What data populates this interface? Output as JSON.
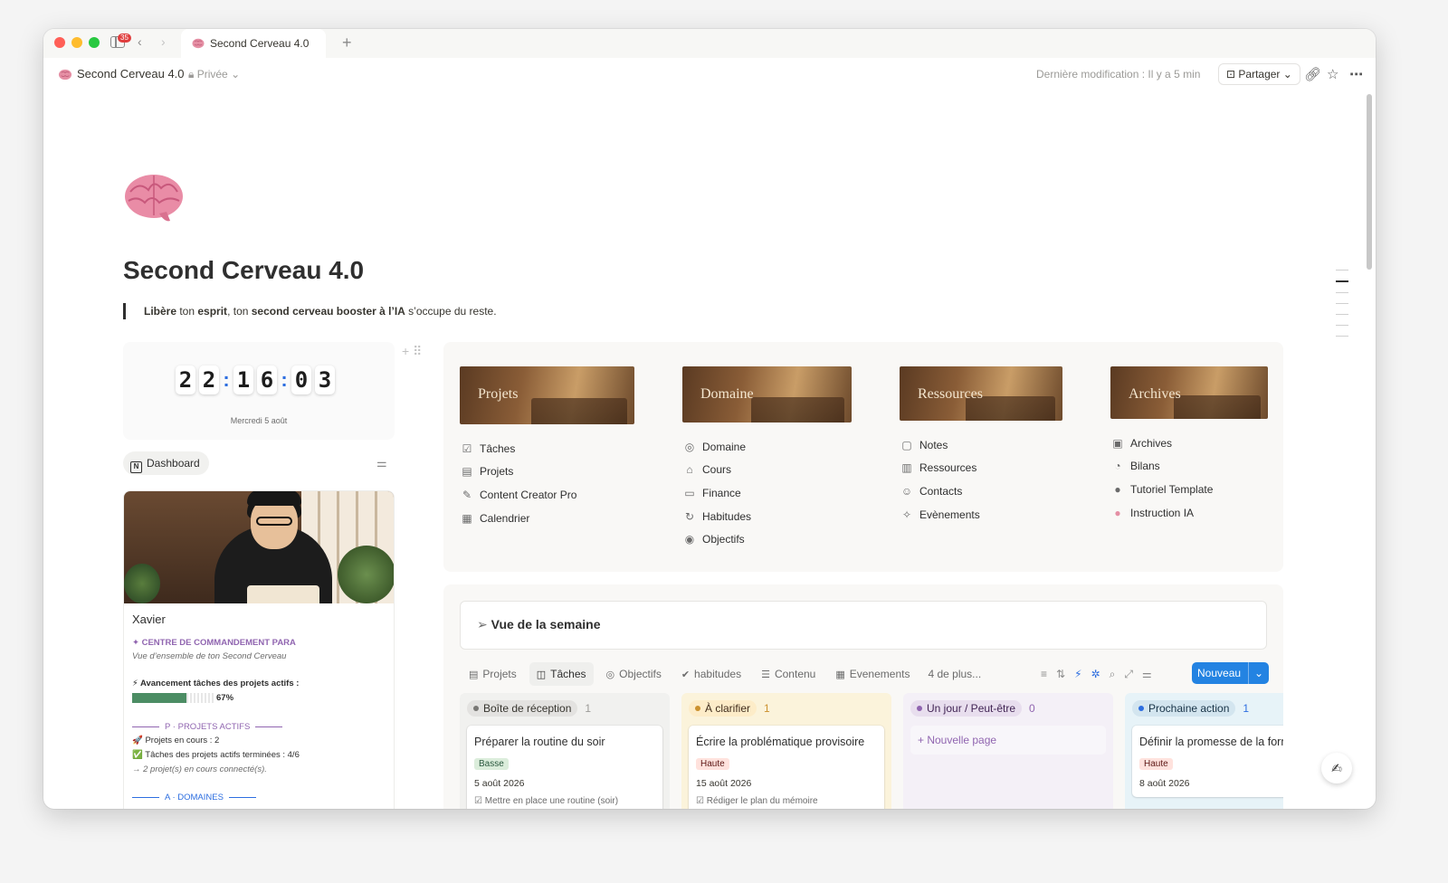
{
  "window": {
    "tab_title": "Second Cerveau 4.0",
    "notification_count": "35"
  },
  "topbar": {
    "breadcrumb": "Second Cerveau 4.0",
    "privacy": "Privée",
    "last_modified": "Dernière modification : Il y a 5 min",
    "share_label": "Partager"
  },
  "page": {
    "title": "Second Cerveau 4.0",
    "quote": {
      "part1": "Libère",
      "part2": " ton ",
      "part3": "esprit",
      "part4": ", ton ",
      "part5": "second cerveau booster à l’IA",
      "part6": " s’occupe du reste."
    }
  },
  "clock": {
    "digits": [
      "2",
      "2",
      "1",
      "6",
      "0",
      "3"
    ],
    "date": "Mercredi 5 août"
  },
  "dashboard": {
    "label": "Dashboard"
  },
  "profile": {
    "name": "Xavier",
    "heading": "✦ CENTRE DE COMMANDEMENT PARA",
    "subtitle": "Vue d’ensemble de ton Second Cerveau",
    "progress_label": "⚡ Avancement tâches des projets actifs :",
    "progress_pct": "67%",
    "progress_value": 0.67,
    "section_projects": "P · PROJETS ACTIFS",
    "projects_in_progress": "🚀 Projets en cours : 2",
    "projects_done": "✅ Tâches des projets actifs terminées : 4/6",
    "projects_linked": "→ 2 projet(s) en cours connecté(s).",
    "section_domains": "A · DOMAINES",
    "accent_purple": "#9065b0",
    "accent_blue": "#2d6ee0"
  },
  "categories": [
    {
      "cover": "Projets",
      "items": [
        "Tâches",
        "Projets",
        "Content Creator Pro",
        "Calendrier"
      ]
    },
    {
      "cover": "Domaine",
      "items": [
        "Domaine",
        "Cours",
        "Finance",
        "Habitudes",
        "Objectifs"
      ]
    },
    {
      "cover": "Ressources",
      "items": [
        "Notes",
        "Ressources",
        "Contacts",
        "Evènements"
      ]
    },
    {
      "cover": "Archives",
      "items": [
        "Archives",
        "Bilans",
        "Tutoriel Template",
        "Instruction IA"
      ]
    }
  ],
  "week": {
    "title": "Vue de la semaine",
    "views": [
      "Projets",
      "Tâches",
      "Objectifs",
      "habitudes",
      "Contenu",
      "Evenements"
    ],
    "active_view": "Tâches",
    "more_views": "4 de plus...",
    "new_label": "Nouveau",
    "columns": [
      {
        "name": "Boîte de réception",
        "count": "1",
        "color": "#787774",
        "bg": "#f1f1ef",
        "card": {
          "title": "Préparer la routine du soir",
          "priority": "Basse",
          "date": "5 août 2026",
          "extra": "☑ Mettre en place une routine (soir)"
        }
      },
      {
        "name": "À clarifier",
        "count": "1",
        "color": "#cb912f",
        "bg": "#fbf3db",
        "card": {
          "title": "Écrire la problématique provisoire",
          "priority": "Haute",
          "date": "15 août 2026",
          "extra": "☑ Rédiger le plan du mémoire"
        }
      },
      {
        "name": "Un jour / Peut-être",
        "count": "0",
        "color": "#9065b0",
        "bg": "#f4f0f7",
        "new_page": "+ Nouvelle page"
      },
      {
        "name": "Prochaine action",
        "count": "1",
        "color": "#2d6ee0",
        "bg": "#e7f3f8",
        "card": {
          "title": "Définir la promesse de la formation",
          "priority": "Haute",
          "date": "8 août 2026"
        }
      }
    ]
  }
}
